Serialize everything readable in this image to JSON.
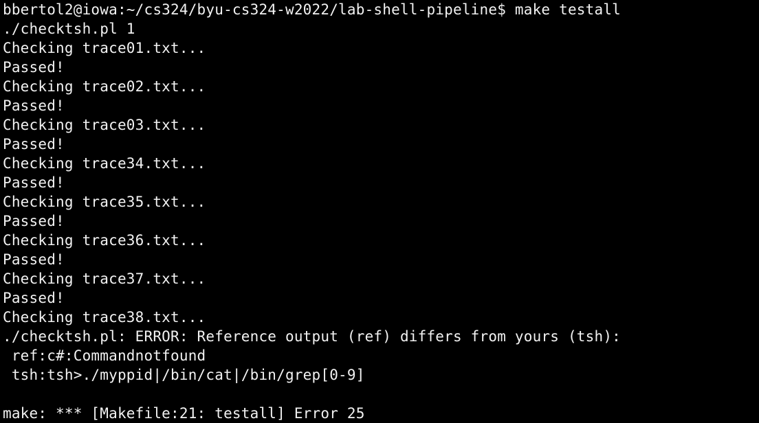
{
  "terminal": {
    "background": "#000000",
    "foreground": "#f2f2f2",
    "lines": [
      "bbertol2@iowa:~/cs324/byu-cs324-w2022/lab-shell-pipeline$ make testall",
      "./checktsh.pl 1",
      "Checking trace01.txt...",
      "Passed!",
      "Checking trace02.txt...",
      "Passed!",
      "Checking trace03.txt...",
      "Passed!",
      "Checking trace34.txt...",
      "Passed!",
      "Checking trace35.txt...",
      "Passed!",
      "Checking trace36.txt...",
      "Passed!",
      "Checking trace37.txt...",
      "Passed!",
      "Checking trace38.txt...",
      "./checktsh.pl: ERROR: Reference output (ref) differs from yours (tsh):",
      " ref:c#:Commandnotfound",
      " tsh:tsh>./myppid|/bin/cat|/bin/grep[0-9]",
      "",
      "make: *** [Makefile:21: testall] Error 25"
    ]
  }
}
